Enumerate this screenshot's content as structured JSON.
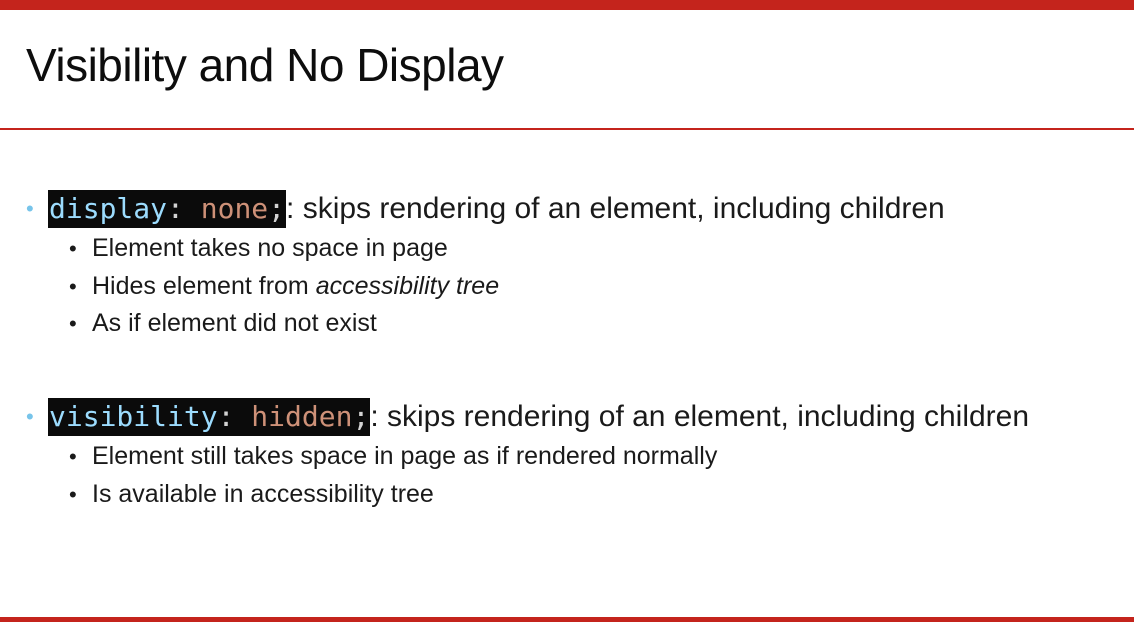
{
  "colors": {
    "accent_red": "#c4241c",
    "bullet_blue": "#77c4ea",
    "code_background": "#0b0b0b",
    "code_property": "#9cdcfe",
    "code_value": "#ce9178"
  },
  "slide": {
    "title": "Visibility and No Display",
    "sections": [
      {
        "code": {
          "property": "display",
          "colon": ":",
          "value": "none",
          "semicolon": ";"
        },
        "description": ": skips rendering of an element, including children",
        "bullets": [
          {
            "text": "Element takes no space in page"
          },
          {
            "prefix": "Hides element from ",
            "emphasis": "accessibility tree"
          },
          {
            "text": "As if element did not exist"
          }
        ]
      },
      {
        "code": {
          "property": "visibility",
          "colon": ":",
          "value": "hidden",
          "semicolon": ";"
        },
        "description": ": skips rendering of an element, including children",
        "bullets": [
          {
            "text": "Element still takes space in page as if rendered normally"
          },
          {
            "text": "Is available in accessibility tree"
          }
        ]
      }
    ]
  },
  "icons": {
    "level1_bullet": "•",
    "level2_bullet": "•"
  }
}
